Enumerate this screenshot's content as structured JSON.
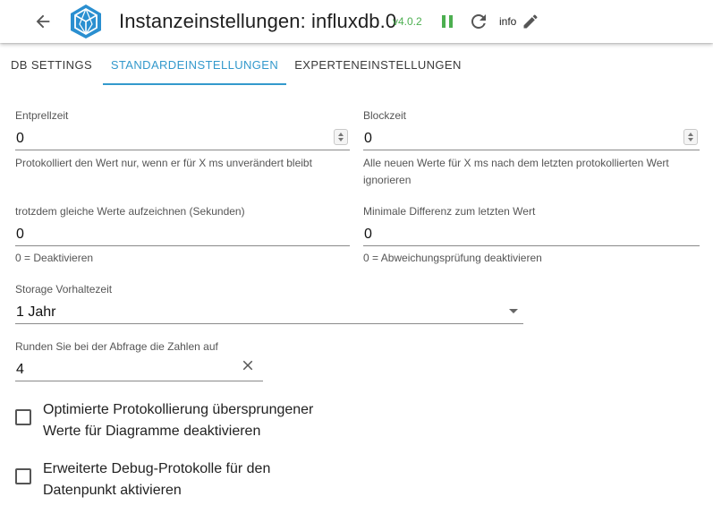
{
  "header": {
    "title": "Instanzeinstellungen: influxdb.0",
    "version": "v4.0.2",
    "info_label": "info",
    "colors": {
      "version": "#4caf50",
      "pause": "#4caf50",
      "accent": "#3399cc",
      "logo": "#2a8fd0"
    },
    "icons": {
      "back": "arrow-left-icon",
      "logo": "influxdb-logo-icon",
      "pause": "pause-icon",
      "reload": "reload-icon",
      "edit": "pencil-icon"
    }
  },
  "tabs": [
    {
      "label": "DB SETTINGS",
      "active": false
    },
    {
      "label": "STANDARDEINSTELLUNGEN",
      "active": true
    },
    {
      "label": "EXPERTENEINSTELLUNGEN",
      "active": false
    }
  ],
  "form": {
    "debounce": {
      "label": "Entprellzeit",
      "value": "0",
      "helper": "Protokolliert den Wert nur, wenn er für X ms unverändert bleibt"
    },
    "blocktime": {
      "label": "Blockzeit",
      "value": "0",
      "helper_line1": "Alle neuen Werte für X ms nach dem letzten protokollierten Wert",
      "helper_line2": "ignorieren"
    },
    "changes_relog": {
      "label": "trotzdem gleiche Werte aufzeichnen (Sekunden)",
      "value": "0",
      "helper": "0 = Deaktivieren"
    },
    "changes_min_delta": {
      "label": "Minimale Differenz zum letzten Wert",
      "value": "0",
      "helper": "0 = Abweichungsprüfung deaktivieren"
    },
    "retention": {
      "label": "Storage Vorhaltezeit",
      "value": "1 Jahr"
    },
    "round": {
      "label": "Runden Sie bei der Abfrage die Zahlen auf",
      "value": "4"
    },
    "checkbox_optimize": {
      "line1": "Optimierte Protokollierung übersprungener",
      "line2": "Werte für Diagramme deaktivieren",
      "checked": false
    },
    "checkbox_debug": {
      "line1": "Erweiterte Debug-Protokolle für den",
      "line2": "Datenpunkt aktivieren",
      "checked": false
    }
  }
}
